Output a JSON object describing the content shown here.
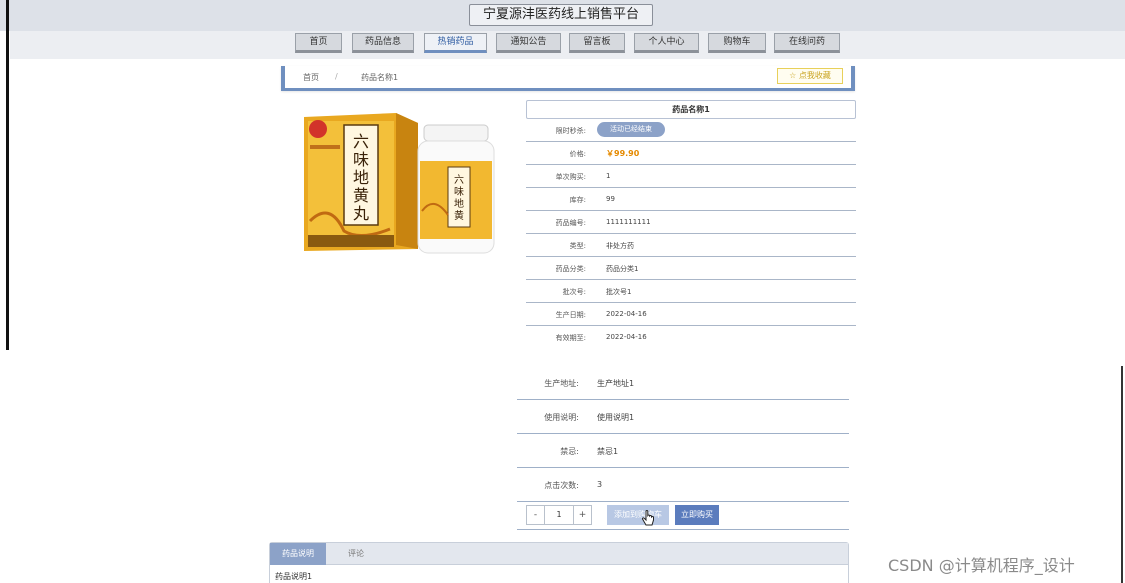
{
  "site_title": "宁夏源沣医药线上销售平台",
  "nav": [
    "首页",
    "药品信息",
    "热销药品",
    "通知公告",
    "留言板",
    "个人中心",
    "购物车",
    "在线问药"
  ],
  "nav_active_index": 2,
  "breadcrumb": {
    "home": "首页",
    "separator": "/",
    "current": "药品名称1"
  },
  "collect_label": "☆ 点我收藏",
  "product": {
    "name": "药品名称1",
    "image_icon": "medicine-box-image",
    "fields": [
      {
        "label": "限时秒杀:",
        "badge": "活动已经结束"
      },
      {
        "label": "价格:",
        "value": "￥99.90",
        "kind": "price"
      },
      {
        "label": "单次购买:",
        "value": "1"
      },
      {
        "label": "库存:",
        "value": "99"
      },
      {
        "label": "药品编号:",
        "value": "1111111111"
      },
      {
        "label": "类型:",
        "value": "非处方药"
      },
      {
        "label": "药品分类:",
        "value": "药品分类1"
      },
      {
        "label": "批次号:",
        "value": "批次号1"
      },
      {
        "label": "生产日期:",
        "value": "2022-04-16"
      },
      {
        "label": "有效期至:",
        "value": "2022-04-16"
      }
    ]
  },
  "lower_fields": [
    {
      "label": "生产地址:",
      "value": "生产地址1"
    },
    {
      "label": "使用说明:",
      "value": "使用说明1"
    },
    {
      "label": "禁忌:",
      "value": "禁忌1"
    },
    {
      "label": "点击次数:",
      "value": "3"
    }
  ],
  "quantity": {
    "minus": "-",
    "value": "1",
    "plus": "+"
  },
  "buttons": {
    "add_cart": "添加到购物车",
    "buy_now": "立即购买"
  },
  "tabs": [
    {
      "label": "药品说明",
      "active": true
    },
    {
      "label": "评论",
      "active": false
    }
  ],
  "tab_content": "药品说明1",
  "watermark": "CSDN @计算机程序_设计",
  "colors": {
    "accent": "#6f8fbf",
    "price": "#e58a00",
    "buy": "#5b7cbd"
  }
}
